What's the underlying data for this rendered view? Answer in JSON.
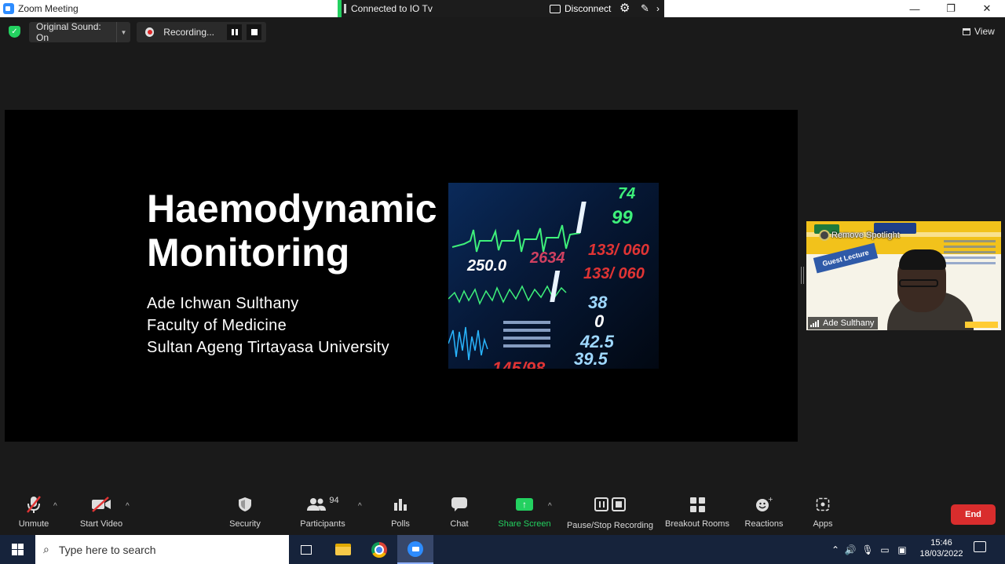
{
  "window": {
    "title": "Zoom Meeting",
    "controls": {
      "minimize": "—",
      "restore": "❐",
      "close": "✕"
    }
  },
  "share_bar": {
    "status": "Connected to IO Tv",
    "disconnect_label": "Disconnect"
  },
  "meeting_top": {
    "original_sound": "Original Sound: On",
    "recording_status": "Recording...",
    "view_label": "View"
  },
  "slide": {
    "title_line1": "Haemodynamic",
    "title_line2": "Monitoring",
    "author": "Ade Ichwan Sulthany",
    "faculty": "Faculty of Medicine",
    "university": "Sultan Ageng Tirtayasa University",
    "monitor_readings": [
      "74",
      "99",
      "133/ 060",
      "133/ 060",
      "250.0",
      "2634",
      "38",
      "0",
      "42.5",
      "39.5",
      "145/98"
    ]
  },
  "video_panel": {
    "remove_spotlight": "Remove Spotlight",
    "banner_text": "Guest Lecture",
    "participant_name": "Ade Sulthany"
  },
  "toolbar": {
    "unmute": "Unmute",
    "start_video": "Start Video",
    "security": "Security",
    "participants": "Participants",
    "participant_count": "94",
    "polls": "Polls",
    "chat": "Chat",
    "share_screen": "Share Screen",
    "pause_stop_recording": "Pause/Stop Recording",
    "breakout_rooms": "Breakout Rooms",
    "reactions": "Reactions",
    "apps": "Apps",
    "end": "End"
  },
  "taskbar": {
    "search_placeholder": "Type here to search",
    "time": "15:46",
    "date": "18/03/2022"
  },
  "colors": {
    "zoom_blue": "#2d8cff",
    "share_green": "#23d160",
    "end_red": "#d92d2d",
    "taskbar_bg": "#16233b"
  }
}
